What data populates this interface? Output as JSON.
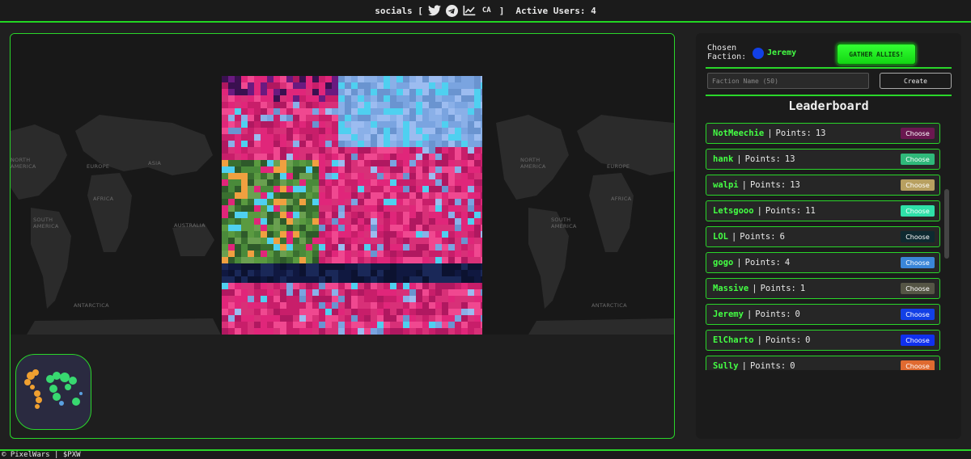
{
  "header": {
    "socials_label": "socials [",
    "socials_close": "]",
    "ca_label": "CA",
    "active_users_label": "Active Users: 4",
    "icons": [
      "twitter-icon",
      "telegram-icon",
      "chart-line-icon"
    ]
  },
  "map": {
    "labels": {
      "north_america_left": "NORTH AMERICA",
      "europe_mid": "EUROPE",
      "asia_mid": "ASIA",
      "africa_mid": "AFRICA",
      "south_america_left": "SOUTH AMERICA",
      "australia_mid": "AUSTRALIA",
      "antarctica_left": "ANTARCTICA",
      "north_america_right": "NORTH AMERICA",
      "europe_right": "EUROPE",
      "africa_right": "AFRICA",
      "south_america_right": "SOUTH AMERICA",
      "antarctica_right": "ANTARCTICA"
    },
    "colors": {
      "pink": "#e0267a",
      "blue": "#7aa4e0",
      "cyan": "#4fd0f0",
      "green": "#4a8a3a"
    }
  },
  "faction": {
    "chosen_label": "Chosen Faction:",
    "chosen_name": "Jeremy",
    "chosen_color": "#1240e6",
    "gather_button": "GATHER ALLIES!",
    "input_placeholder": "Faction Name (50)",
    "create_button": "Create"
  },
  "leaderboard": {
    "title": "Leaderboard",
    "points_prefix": "Points:",
    "choose_label": "Choose",
    "items": [
      {
        "name": "NotMeechie",
        "points": "13",
        "color": "#6a1850"
      },
      {
        "name": "hank",
        "points": "13",
        "color": "#2fb87a"
      },
      {
        "name": "walpi",
        "points": "13",
        "color": "#b8a060"
      },
      {
        "name": "Letsgooo",
        "points": "11",
        "color": "#2fe0a8"
      },
      {
        "name": "LOL",
        "points": "6",
        "color": "#0e2a30"
      },
      {
        "name": "gogo",
        "points": "4",
        "color": "#3a86d8"
      },
      {
        "name": "Massive",
        "points": "1",
        "color": "#555545"
      },
      {
        "name": "Jeremy",
        "points": "0",
        "color": "#1240e6"
      },
      {
        "name": "ElCharto",
        "points": "0",
        "color": "#1030ee"
      },
      {
        "name": "Sully",
        "points": "0",
        "color": "#e06a30"
      }
    ]
  },
  "footer": {
    "text": "© PixelWars | $PXW"
  }
}
